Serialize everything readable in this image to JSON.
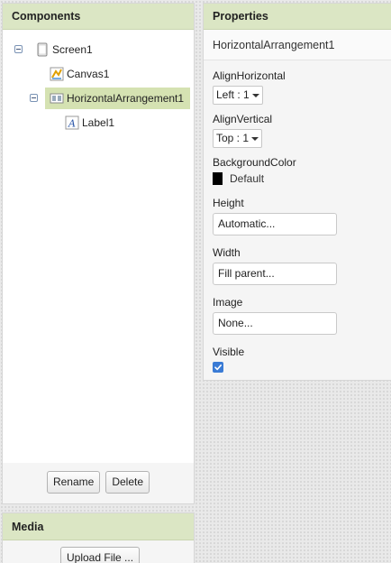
{
  "components_panel": {
    "title": "Components",
    "tree": [
      {
        "label": "Screen1",
        "icon": "screen-icon"
      },
      {
        "label": "Canvas1",
        "icon": "canvas-icon"
      },
      {
        "label": "HorizontalArrangement1",
        "icon": "horizontal-arrangement-icon",
        "selected": true
      },
      {
        "label": "Label1",
        "icon": "label-icon"
      }
    ],
    "rename_label": "Rename",
    "delete_label": "Delete"
  },
  "media_panel": {
    "title": "Media",
    "upload_label": "Upload File ..."
  },
  "properties_panel": {
    "title": "Properties",
    "component_name": "HorizontalArrangement1",
    "align_horizontal": {
      "label": "AlignHorizontal",
      "value": "Left : 1"
    },
    "align_vertical": {
      "label": "AlignVertical",
      "value": "Top : 1"
    },
    "background_color": {
      "label": "BackgroundColor",
      "value": "Default",
      "swatch": "#000000"
    },
    "height": {
      "label": "Height",
      "value": "Automatic..."
    },
    "width": {
      "label": "Width",
      "value": "Fill parent..."
    },
    "image": {
      "label": "Image",
      "value": "None..."
    },
    "visible": {
      "label": "Visible",
      "checked": true
    }
  },
  "colors": {
    "header_bg": "#dbe6c4",
    "selected_bg": "#d5e2b2",
    "checkbox_blue": "#3a7bd5"
  }
}
